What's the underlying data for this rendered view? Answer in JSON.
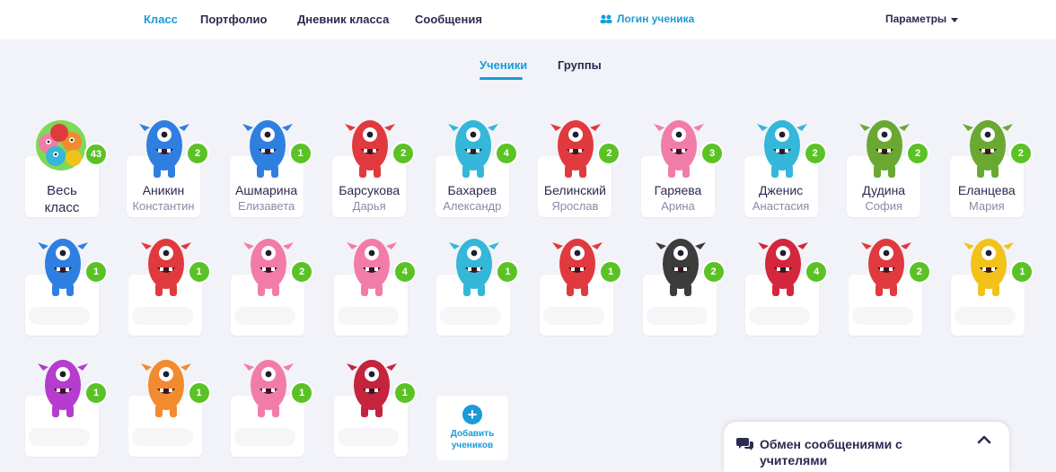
{
  "nav": {
    "class_label": "Класс",
    "portfolio_label": "Портфолио",
    "diary_label": "Дневник класса",
    "messages_label": "Сообщения",
    "login_label": "Логин ученика",
    "params_label": "Параметры"
  },
  "tabs": {
    "students": "Ученики",
    "groups": "Группы"
  },
  "whole_class": {
    "line1": "Весь",
    "line2": "класс",
    "points": "43"
  },
  "students_row1": [
    {
      "last": "Аникин",
      "first": "Константин",
      "points": "2",
      "color": "#2f7fe0"
    },
    {
      "last": "Ашмарина",
      "first": "Елизавета",
      "points": "1",
      "color": "#2f7fe0"
    },
    {
      "last": "Барсукова",
      "first": "Дарья",
      "points": "2",
      "color": "#e03a3e"
    },
    {
      "last": "Бахарев",
      "first": "Александр",
      "points": "4",
      "color": "#34b7d9"
    },
    {
      "last": "Белинский",
      "first": "Ярослав",
      "points": "2",
      "color": "#e03a3e"
    },
    {
      "last": "Гаряева",
      "first": "Арина",
      "points": "3",
      "color": "#f27ca8"
    },
    {
      "last": "Дженис",
      "first": "Анастасия",
      "points": "2",
      "color": "#34b7d9"
    },
    {
      "last": "Дудина",
      "first": "София",
      "points": "2",
      "color": "#6aa832"
    },
    {
      "last": "Еланцева",
      "first": "Мария",
      "points": "2",
      "color": "#6aa832"
    }
  ],
  "students_row2": [
    {
      "points": "1",
      "color": "#2f7fe0"
    },
    {
      "points": "1",
      "color": "#e03a3e"
    },
    {
      "points": "2",
      "color": "#f27ca8"
    },
    {
      "points": "4",
      "color": "#f27ca8"
    },
    {
      "points": "1",
      "color": "#34b7d9"
    },
    {
      "points": "1",
      "color": "#e03a3e"
    },
    {
      "points": "2",
      "color": "#3c3c3c"
    },
    {
      "points": "4",
      "color": "#d4263c"
    },
    {
      "points": "2",
      "color": "#e03a3e"
    },
    {
      "points": "1",
      "color": "#f2c21b"
    }
  ],
  "students_row3": [
    {
      "points": "1",
      "color": "#b53ccf"
    },
    {
      "points": "1",
      "color": "#f28a2e"
    },
    {
      "points": "1",
      "color": "#f27ca8"
    },
    {
      "points": "1",
      "color": "#c4243c"
    }
  ],
  "add_students": {
    "line1": "Добавить",
    "line2": "учеников"
  },
  "messaging": {
    "label": "Обмен сообщениями с учителями"
  }
}
